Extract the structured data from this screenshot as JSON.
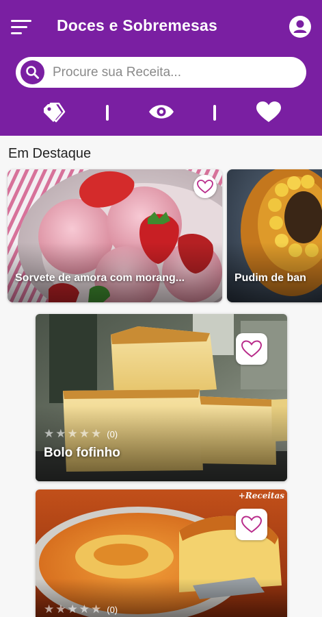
{
  "header": {
    "title": "Doces e Sobremesas",
    "menu_icon": "menu-icon",
    "profile_icon": "profile-icon"
  },
  "search": {
    "placeholder": "Procure sua Receita..."
  },
  "quick_nav": {
    "icons": [
      "tags-icon",
      "eye-icon",
      "heart-icon"
    ]
  },
  "featured": {
    "title": "Em Destaque",
    "items": [
      {
        "label": "Sorvete de amora com morang..."
      },
      {
        "label": "Pudim de ban"
      }
    ]
  },
  "recipes": [
    {
      "title": "Bolo fofinho",
      "rating_count": "(0)",
      "stars": 0,
      "watermark": ""
    },
    {
      "title": "",
      "rating_count": "(0)",
      "stars": 0,
      "watermark": "+Receitas"
    }
  ],
  "colors": {
    "primary": "#7a1fa2",
    "white": "#ffffff"
  }
}
